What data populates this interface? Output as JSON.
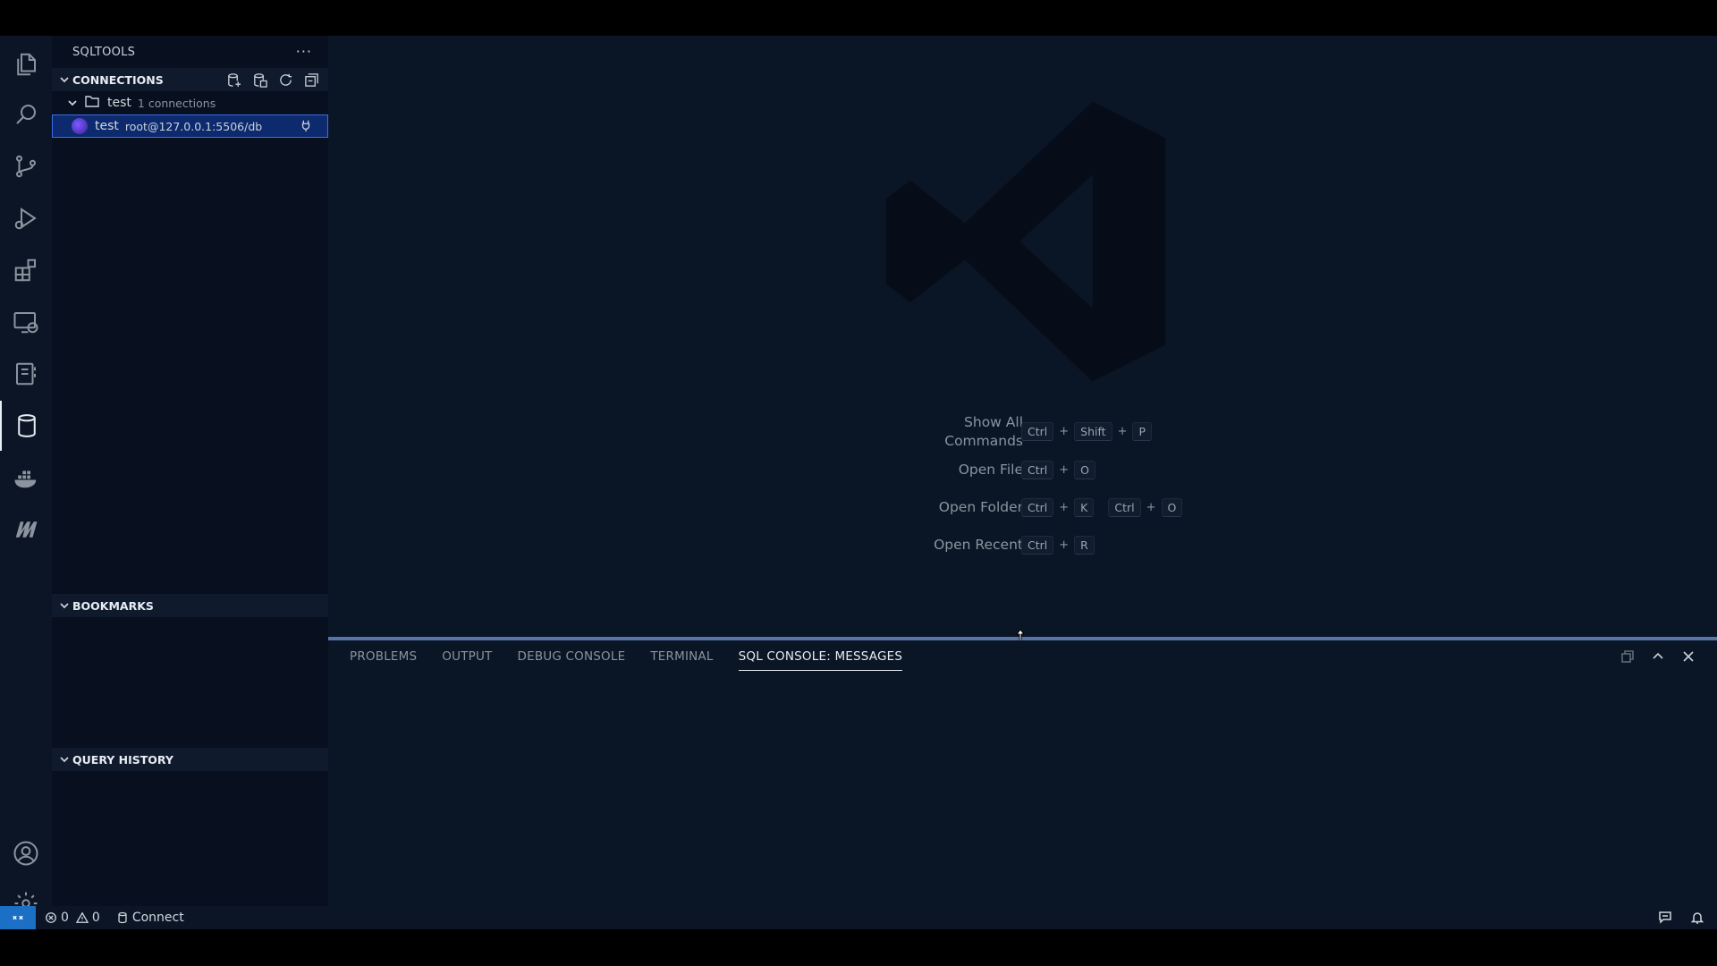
{
  "activity_bar": {
    "icons": [
      "explorer-icon",
      "search-icon",
      "source-control-icon",
      "run-debug-icon",
      "extensions-icon",
      "remote-explorer-icon",
      "notebook-icon",
      "database-icon",
      "docker-icon",
      "mongodb-icon",
      "account-icon",
      "settings-gear-icon"
    ],
    "active": "database-icon"
  },
  "sidebar": {
    "title": "SQLTOOLS",
    "more_label": "···",
    "connections": {
      "header": "CONNECTIONS",
      "group": {
        "name": "test",
        "count_label": "1 connections"
      },
      "item": {
        "name": "test",
        "detail": "root@127.0.0.1:5506/db"
      }
    },
    "bookmarks_header": "BOOKMARKS",
    "query_history_header": "QUERY HISTORY"
  },
  "editor": {
    "shortcuts": [
      {
        "label_line1": "Show All",
        "label_line2": "Commands",
        "keys": [
          [
            "Ctrl",
            "Shift",
            "P"
          ]
        ]
      },
      {
        "label_line1": "Open File",
        "label_line2": "",
        "keys": [
          [
            "Ctrl",
            "O"
          ]
        ]
      },
      {
        "label_line1": "Open Folder",
        "label_line2": "",
        "keys": [
          [
            "Ctrl",
            "K"
          ],
          [
            "Ctrl",
            "O"
          ]
        ]
      },
      {
        "label_line1": "Open Recent",
        "label_line2": "",
        "keys": [
          [
            "Ctrl",
            "R"
          ]
        ]
      }
    ]
  },
  "panel": {
    "tabs": [
      "PROBLEMS",
      "OUTPUT",
      "DEBUG CONSOLE",
      "TERMINAL",
      "SQL CONSOLE: MESSAGES"
    ],
    "active_tab": "SQL CONSOLE: MESSAGES"
  },
  "status_bar": {
    "errors": "0",
    "warnings": "0",
    "connect_label": "Connect"
  },
  "colors": {
    "accent_blue": "#1b6fc4",
    "selection": "#0d2a6e",
    "editor_bg": "#0a1525"
  }
}
